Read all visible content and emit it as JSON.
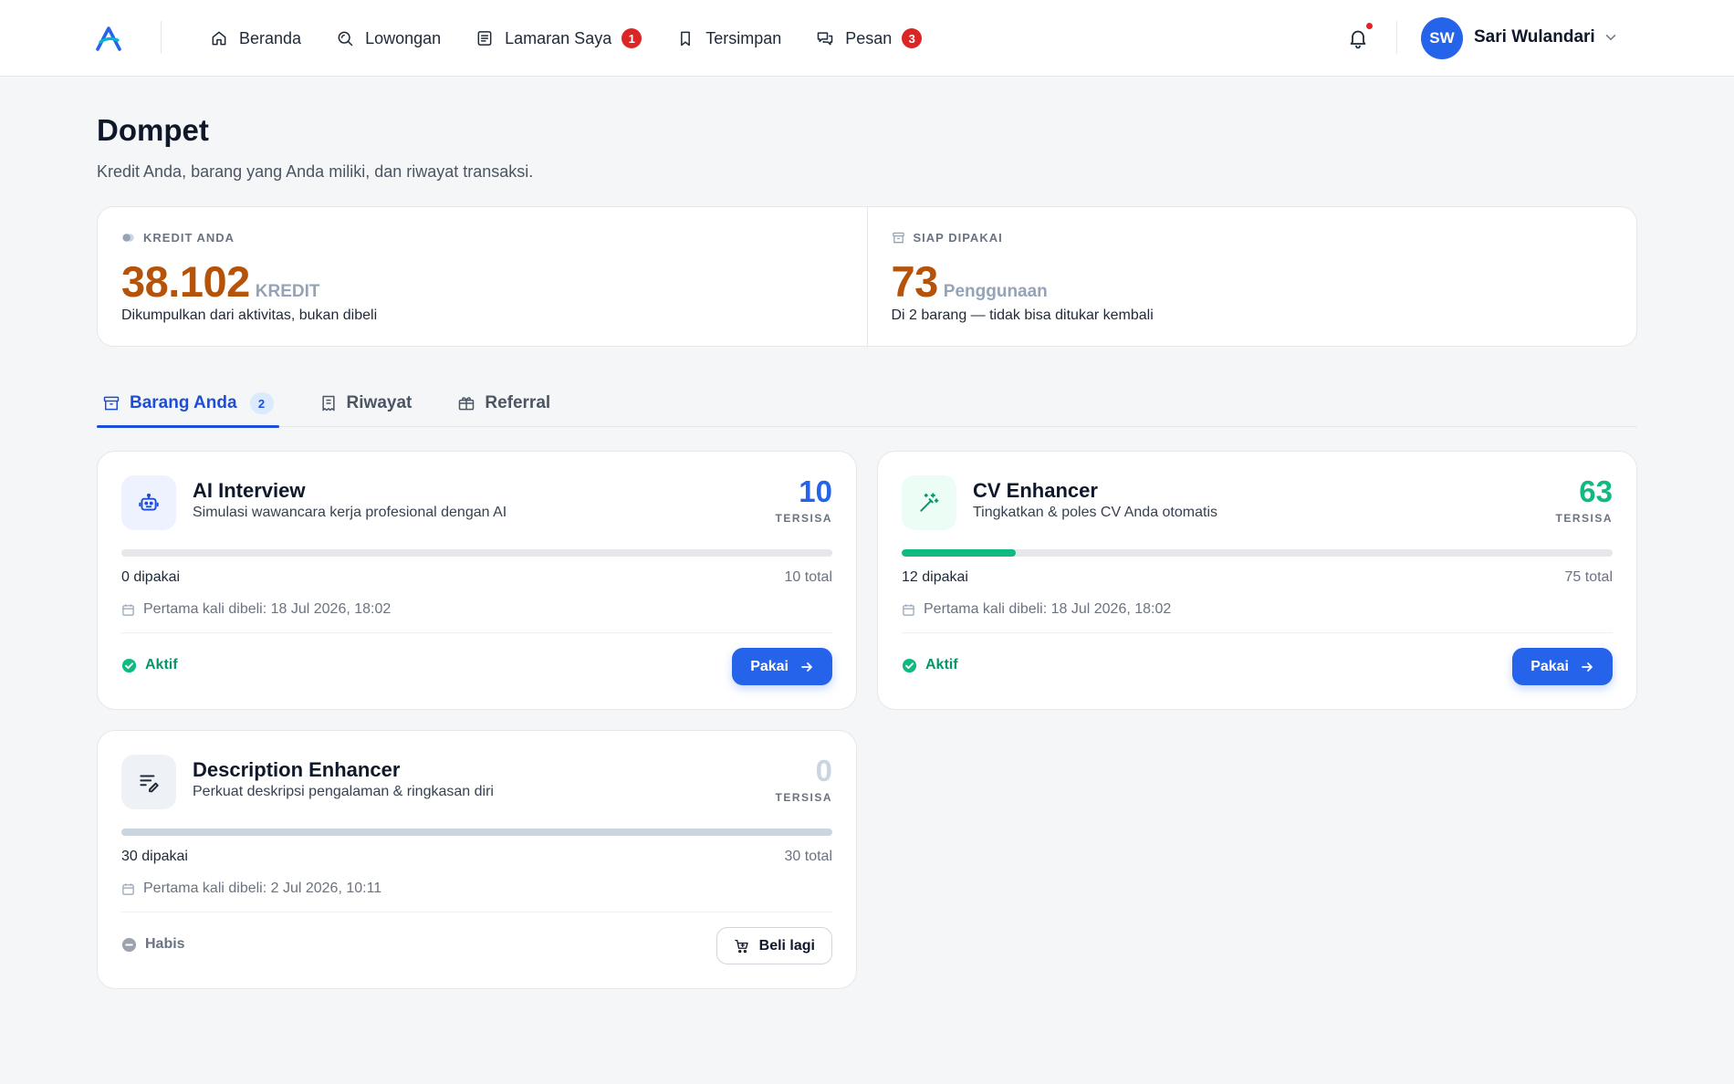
{
  "nav": {
    "items": [
      {
        "label": "Beranda",
        "icon": "home-icon"
      },
      {
        "label": "Lowongan",
        "icon": "search-jobs-icon"
      },
      {
        "label": "Lamaran Saya",
        "icon": "document-icon",
        "badge": "1"
      },
      {
        "label": "Tersimpan",
        "icon": "bookmark-icon"
      },
      {
        "label": "Pesan",
        "icon": "chat-icon",
        "badge": "3"
      }
    ]
  },
  "user": {
    "initials": "SW",
    "name": "Sari Wulandari"
  },
  "page": {
    "title": "Dompet",
    "subtitle": "Kredit Anda, barang yang Anda miliki, dan riwayat transaksi."
  },
  "stats": {
    "credit": {
      "label": "KREDIT ANDA",
      "value": "38.102",
      "unit": "KREDIT",
      "desc": "Dikumpulkan dari aktivitas, bukan dibeli"
    },
    "ready": {
      "label": "SIAP DIPAKAI",
      "value": "73",
      "unit": "Penggunaan",
      "desc": "Di 2 barang — tidak bisa ditukar kembali"
    }
  },
  "tabs": [
    {
      "label": "Barang Anda",
      "badge": "2",
      "active": true
    },
    {
      "label": "Riwayat"
    },
    {
      "label": "Referral"
    }
  ],
  "items": [
    {
      "title": "AI Interview",
      "desc": "Simulasi wawancara kerja profesional dengan AI",
      "remaining": "10",
      "remaining_label": "TERSISA",
      "used_label": "0 dipakai",
      "total_label": "10 total",
      "used_fraction": 0,
      "bought": "Pertama kali dibeli: 18 Jul 2026, 18:02",
      "status": "Aktif",
      "action": "Pakai",
      "accent": "#2563eb",
      "icon": "robot-icon"
    },
    {
      "title": "CV Enhancer",
      "desc": "Tingkatkan & poles CV Anda otomatis",
      "remaining": "63",
      "remaining_label": "TERSISA",
      "used_label": "12 dipakai",
      "total_label": "75 total",
      "used_fraction": 0.16,
      "bought": "Pertama kali dibeli: 18 Jul 2026, 18:02",
      "status": "Aktif",
      "action": "Pakai",
      "accent": "#10b981",
      "icon": "magic-wand-icon"
    },
    {
      "title": "Description Enhancer",
      "desc": "Perkuat deskripsi pengalaman & ringkasan diri",
      "remaining": "0",
      "remaining_label": "TERSISA",
      "used_label": "30 dipakai",
      "total_label": "30 total",
      "used_fraction": 1,
      "bought": "Pertama kali dibeli: 2 Jul 2026, 10:11",
      "status": "Habis",
      "action": "Beli lagi",
      "accent": "#cbd5e1",
      "icon": "edit-lines-icon"
    }
  ]
}
